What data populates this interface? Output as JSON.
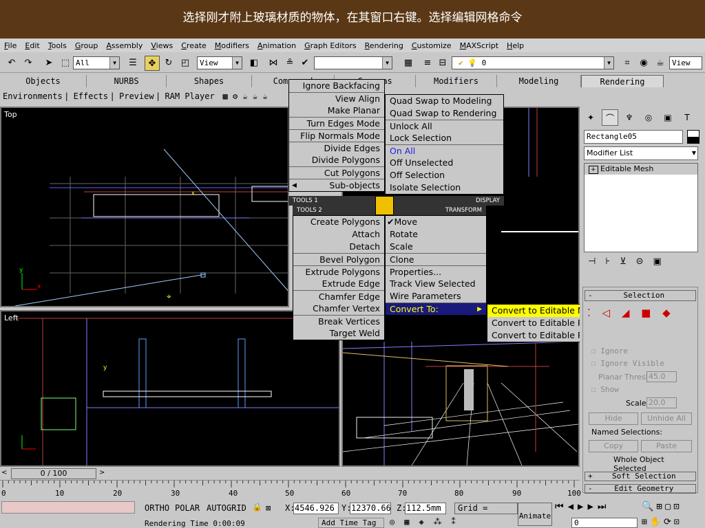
{
  "banner": {
    "caption": "选择刚才附上玻璃材质的物体，在其窗口右键。选择编辑网格命令"
  },
  "menubar": [
    "File",
    "Edit",
    "Tools",
    "Group",
    "Assembly",
    "Views",
    "Create",
    "Modifiers",
    "Animation",
    "Graph Editors",
    "Rendering",
    "Customize",
    "MAXScript",
    "Help"
  ],
  "toolbar": {
    "selection_filter": "All",
    "ref_coord": "View",
    "named_sel": "",
    "layer": "0",
    "view_right": "View"
  },
  "tabs": [
    "Objects",
    "NURBS",
    "Shapes",
    "Compound",
    "Cameras",
    "Modifiers",
    "Modeling",
    "Rendering"
  ],
  "tabrow2": [
    "Environments",
    "Effects",
    "Preview",
    "RAM Player"
  ],
  "viewports": {
    "top": "Top",
    "left": "Left"
  },
  "quad": {
    "tl": [
      "Ignore Backfacing",
      "View Align",
      "Make Planar",
      "Turn Edges Mode",
      "Flip Normals Mode",
      "Divide Edges",
      "Divide Polygons",
      "Cut Polygons",
      "Sub-objects"
    ],
    "tr": [
      "Quad Swap to Modeling",
      "Quad Swap to Rendering",
      "Unlock All",
      "Lock Selection",
      "On All",
      "Off Unselected",
      "Off Selection",
      "Isolate Selection"
    ],
    "tools1": "TOOLS 1",
    "display": "DISPLAY",
    "tools2": "TOOLS 2",
    "transform": "TRANSFORM",
    "bl": [
      "Create Polygons",
      "Attach",
      "Detach",
      "Bevel Polygon",
      "Extrude Polygons",
      "Extrude Edge",
      "Chamfer Edge",
      "Chamfer Vertex",
      "Break Vertices",
      "Target Weld"
    ],
    "br": [
      "Move",
      "Rotate",
      "Scale",
      "Clone",
      "Properties...",
      "Track View Selected",
      "Wire Parameters",
      "Convert To:"
    ],
    "submenu": [
      "Convert to Editable Mesh",
      "Convert to Editable Poly",
      "Convert to Editable Patch"
    ]
  },
  "cmd": {
    "object_name": "Rectangle05",
    "modifier_list": "Modifier List",
    "stack_item": "Editable Mesh",
    "selection_title": "Selection",
    "ignore": "Ignore",
    "ignore_visible": "Ignore Visible",
    "planar_thresh": "Planar Thresh:",
    "planar_val": "45.0",
    "show": "Show",
    "scale": "Scale:",
    "scale_val": "20.0",
    "hide": "Hide",
    "unhide_all": "Unhide All",
    "named_selections": "Named Selections:",
    "copy": "Copy",
    "paste": "Paste",
    "whole_object": "Whole Object Selected",
    "soft_selection": "Soft Selection",
    "edit_geometry": "Edit Geometry"
  },
  "timeline": {
    "frame": "0 / 100",
    "ticks": [
      "0",
      "10",
      "20",
      "30",
      "40",
      "50",
      "60",
      "70",
      "80",
      "90",
      "100"
    ]
  },
  "status": {
    "ortho": "ORTHO",
    "polar": "POLAR",
    "autogrid": "AUTOGRID",
    "x": "4546.926",
    "y": "12370.66",
    "z": "112.5mm",
    "grid": "Grid = 10.0mm",
    "render_time": "Rendering Time  0:00:09",
    "add_time_tag": "Add Time Tag",
    "animate": "Animate",
    "frame": "0"
  },
  "colors": {
    "banner": "#5a3815",
    "highlight": "#1a1a7c",
    "highlight_text": "#ffff00",
    "submenu_bg": "#ffff00"
  }
}
